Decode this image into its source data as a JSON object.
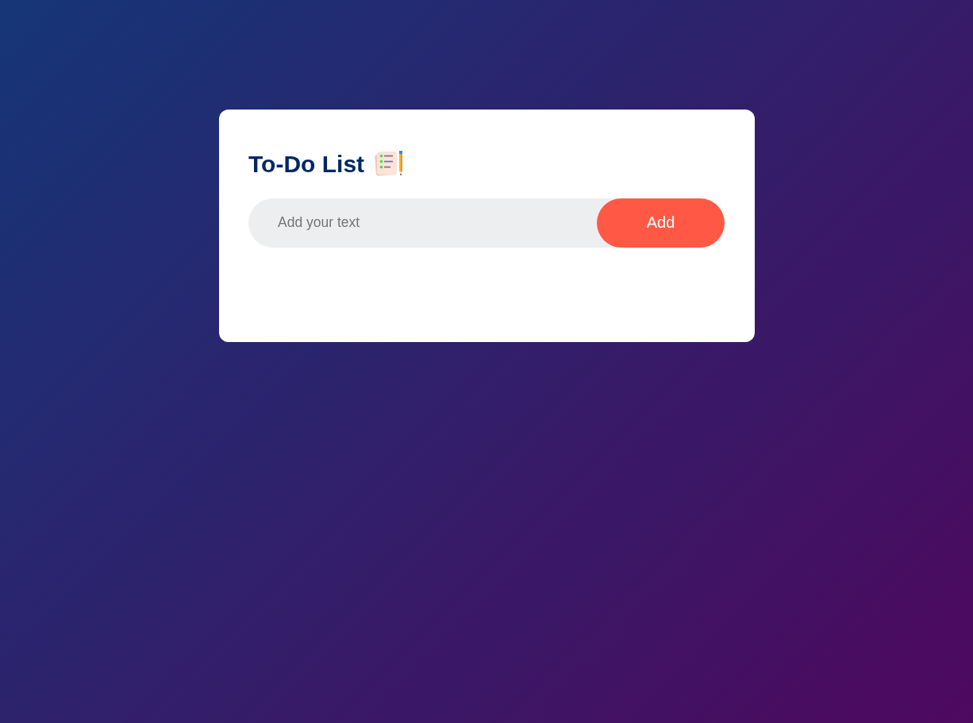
{
  "card": {
    "title": "To-Do List",
    "input": {
      "placeholder": "Add your text"
    },
    "add_button": {
      "label": "Add"
    }
  }
}
